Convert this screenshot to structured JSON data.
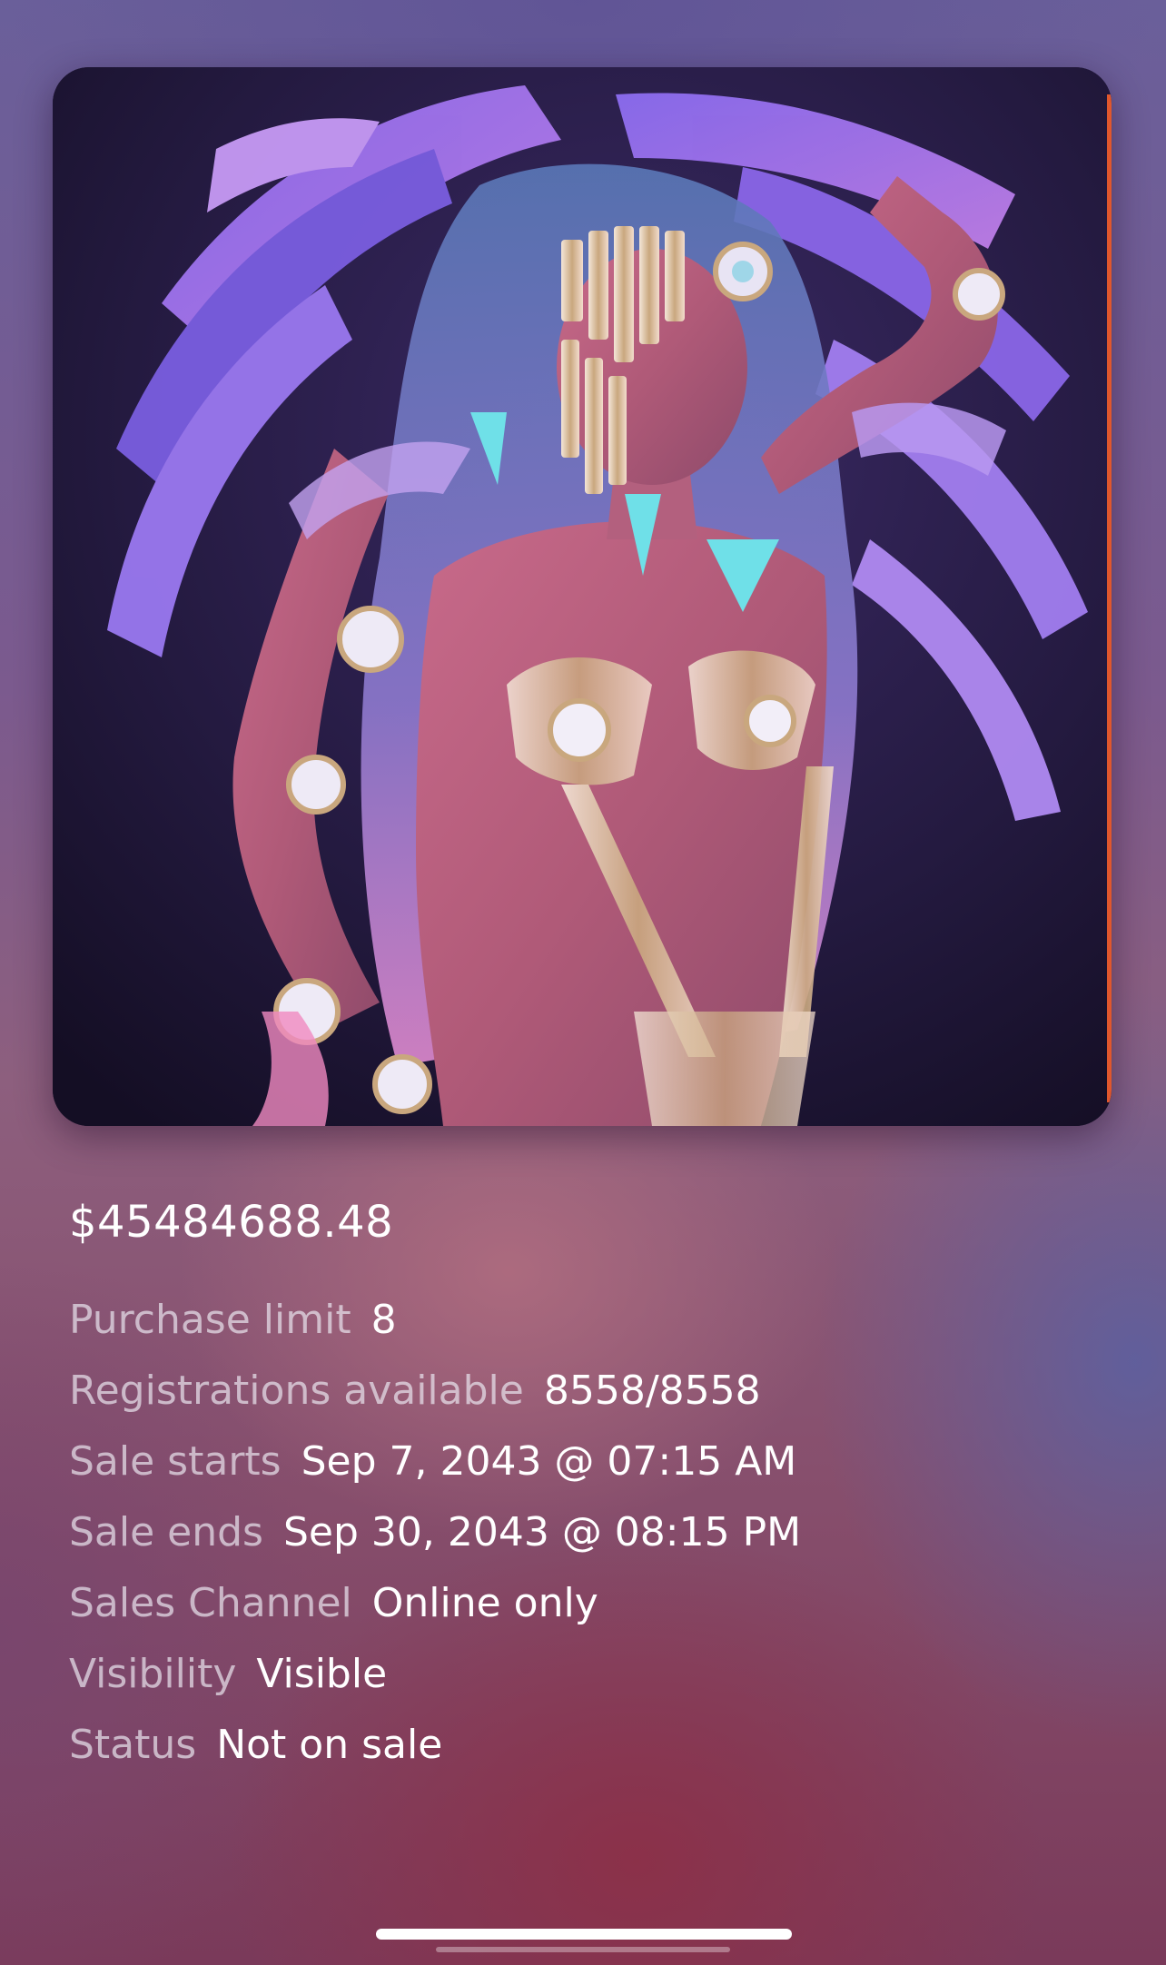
{
  "product": {
    "price": "$45484688.48",
    "image_alt": "Carnival costume photo"
  },
  "details": [
    {
      "label": "Purchase limit",
      "value": "8"
    },
    {
      "label": "Registrations available",
      "value": "8558/8558"
    },
    {
      "label": "Sale starts",
      "value": "Sep 7, 2043 @ 07:15 AM"
    },
    {
      "label": "Sale ends",
      "value": "Sep 30, 2043 @ 08:15 PM"
    },
    {
      "label": "Sales Channel",
      "value": "Online only"
    },
    {
      "label": "Visibility",
      "value": "Visible"
    },
    {
      "label": "Status",
      "value": "Not on sale"
    }
  ],
  "colors": {
    "background_top": "#6a5f9a",
    "background_bottom": "#7a3a5a",
    "label_text": "#e8e2ec",
    "value_text": "#ffffff",
    "image_edge_accent": "#e0572d"
  }
}
